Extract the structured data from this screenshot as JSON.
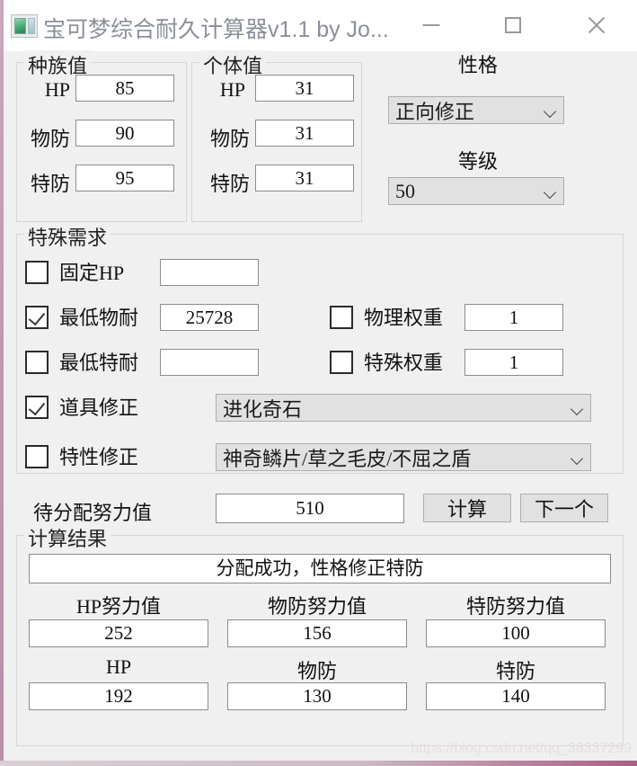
{
  "window": {
    "title": "宝可梦综合耐久计算器v1.1 by Jo...",
    "icon": "app-form-icon",
    "minimize": "—",
    "maximize": "□",
    "close": "✕"
  },
  "base_stats": {
    "group_title": "种族值",
    "rows": [
      {
        "label": "HP",
        "value": "85"
      },
      {
        "label": "物防",
        "value": "90"
      },
      {
        "label": "特防",
        "value": "95"
      }
    ]
  },
  "ivs": {
    "group_title": "个体值",
    "rows": [
      {
        "label": "HP",
        "value": "31"
      },
      {
        "label": "物防",
        "value": "31"
      },
      {
        "label": "特防",
        "value": "31"
      }
    ]
  },
  "nature": {
    "label": "性格",
    "value": "正向修正"
  },
  "level": {
    "label": "等级",
    "value": "50"
  },
  "special": {
    "group_title": "特殊需求",
    "fixed_hp": {
      "label": "固定HP",
      "checked": false,
      "value": ""
    },
    "min_pdef": {
      "label": "最低物耐",
      "checked": true,
      "value": "25728"
    },
    "min_sdef": {
      "label": "最低特耐",
      "checked": false,
      "value": ""
    },
    "phys_weight": {
      "label": "物理权重",
      "checked": false,
      "value": "1"
    },
    "spec_weight": {
      "label": "特殊权重",
      "checked": false,
      "value": "1"
    },
    "item_mod": {
      "label": "道具修正",
      "checked": true,
      "value": "进化奇石"
    },
    "ability_mod": {
      "label": "特性修正",
      "checked": false,
      "value": "神奇鳞片/草之毛皮/不屈之盾"
    }
  },
  "allocation": {
    "label": "待分配努力值",
    "value": "510",
    "calc_button": "计算",
    "next_button": "下一个"
  },
  "result": {
    "group_title": "计算结果",
    "status": "分配成功，性格修正特防",
    "ev_labels": [
      "HP努力值",
      "物防努力值",
      "特防努力值"
    ],
    "ev_values": [
      "252",
      "156",
      "100"
    ],
    "stat_labels": [
      "HP",
      "物防",
      "特防"
    ],
    "stat_values": [
      "192",
      "130",
      "140"
    ]
  },
  "watermark": "https://blog.csdn.net/qq_38337299",
  "colors": {
    "window_bg": "#f0f0f0",
    "titlebar_bg": "#ffffff",
    "title_text": "#8b8f99",
    "field_bg": "#ffffff",
    "field_border": "#8c8c8c",
    "combo_bg": "#e1e1e1",
    "group_border": "#d6d6d6"
  }
}
